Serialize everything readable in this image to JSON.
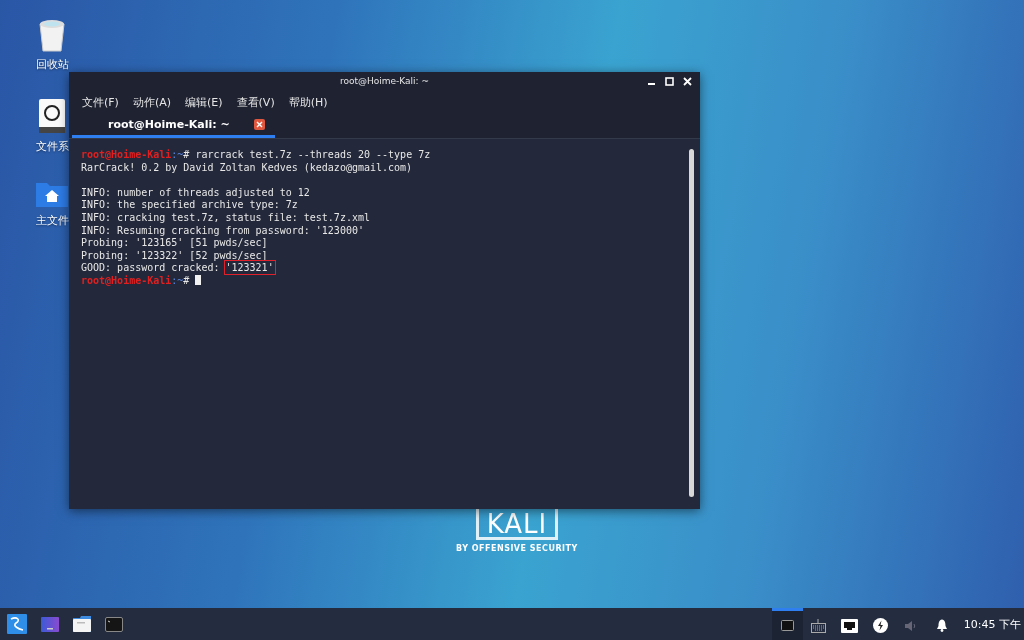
{
  "desktop": {
    "icons": [
      {
        "kind": "trash",
        "label": "回收站"
      },
      {
        "kind": "drive",
        "label": "文件系"
      },
      {
        "kind": "home",
        "label": "主文件"
      }
    ],
    "logo": {
      "wordmark": "KALI",
      "tagline": "BY OFFENSIVE SECURITY"
    }
  },
  "window": {
    "title": "root@Hoime-Kali: ~",
    "menu": [
      "文件(F)",
      "动作(A)",
      "编辑(E)",
      "查看(V)",
      "帮助(H)"
    ],
    "tabs": [
      {
        "label": "root@Hoime-Kali: ~",
        "selected": true
      }
    ],
    "lines": [
      {
        "kind": "prompt",
        "user": "root@Hoime-Kali",
        "path": ":~",
        "sign": "#",
        "command": " rarcrack test.7z --threads 20 --type 7z"
      },
      {
        "kind": "text",
        "text": "RarCrack! 0.2 by David Zoltan Kedves (kedazo@gmail.com)"
      },
      {
        "kind": "blank"
      },
      {
        "kind": "text",
        "text": "INFO: number of threads adjusted to 12"
      },
      {
        "kind": "text",
        "text": "INFO: the specified archive type: 7z"
      },
      {
        "kind": "text",
        "text": "INFO: cracking test.7z, status file: test.7z.xml"
      },
      {
        "kind": "text",
        "text": "INFO: Resuming cracking from password: '123000'"
      },
      {
        "kind": "text",
        "text": "Probing: '123165' [51 pwds/sec]"
      },
      {
        "kind": "text",
        "text": "Probing: '123322' [52 pwds/sec]"
      },
      {
        "kind": "highlight",
        "text": "GOOD: password cracked: ",
        "highlight": "'123321'"
      },
      {
        "kind": "prompt",
        "user": "root@Hoime-Kali",
        "path": ":~",
        "sign": "#",
        "cursor": true
      }
    ]
  },
  "taskbar": {
    "launchers": [
      {
        "kind": "menu"
      },
      {
        "kind": "desktop"
      },
      {
        "kind": "files"
      },
      {
        "kind": "terminal"
      }
    ],
    "tray": [
      {
        "kind": "window",
        "selected": true
      },
      {
        "kind": "keyboard",
        "selected": false
      },
      {
        "kind": "network",
        "selected": false
      },
      {
        "kind": "power",
        "selected": false
      },
      {
        "kind": "volume",
        "selected": false
      },
      {
        "kind": "bell",
        "selected": false
      }
    ],
    "clock": "10:45 下午"
  }
}
